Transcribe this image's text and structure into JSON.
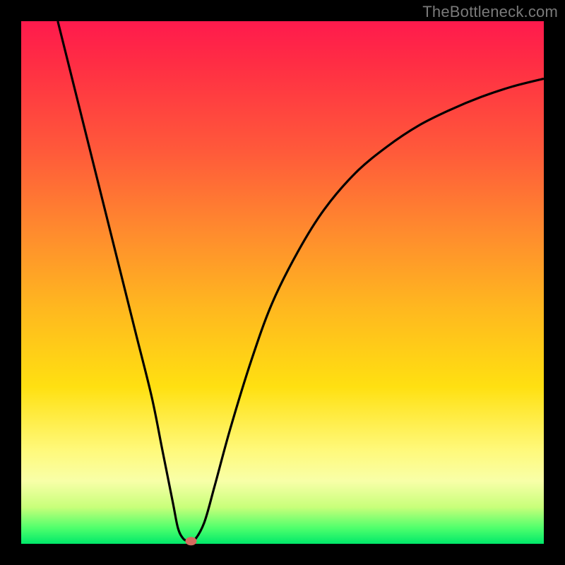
{
  "watermark": "TheBottleneck.com",
  "chart_data": {
    "type": "line",
    "title": "",
    "xlabel": "",
    "ylabel": "",
    "xlim": [
      0,
      100
    ],
    "ylim": [
      0,
      100
    ],
    "grid": false,
    "legend": false,
    "series": [
      {
        "name": "curve",
        "x": [
          7,
          10,
          13,
          16,
          19,
          22,
          25,
          27,
          29,
          30,
          31,
          32,
          33,
          35,
          37,
          40,
          44,
          48,
          53,
          58,
          64,
          70,
          76,
          82,
          88,
          94,
          100
        ],
        "y": [
          100,
          88,
          76,
          64,
          52,
          40,
          28,
          18,
          8,
          3,
          1,
          0.5,
          0.5,
          4,
          11,
          22,
          35,
          46,
          56,
          64,
          71,
          76,
          80,
          83,
          85.5,
          87.5,
          89
        ]
      }
    ],
    "marker": {
      "x": 32.5,
      "y": 0.5,
      "color": "#d46a5e"
    },
    "colors": {
      "curve": "#000000",
      "background_top": "#ff1a4d",
      "background_bottom": "#00e86a",
      "marker": "#d46a5e",
      "frame": "#000000"
    }
  }
}
